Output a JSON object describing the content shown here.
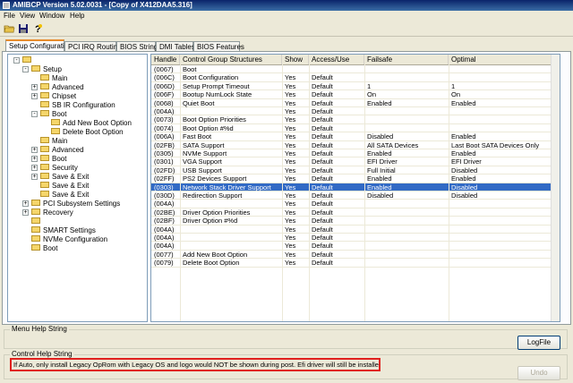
{
  "window": {
    "title": "AMIBCP Version 5.02.0031 - [Copy of X412DAA5.316]"
  },
  "menu": [
    "File",
    "View",
    "Window",
    "Help"
  ],
  "toolbar": {
    "icons": [
      "open-folder-icon",
      "save-icon",
      "help-icon"
    ]
  },
  "tabs": [
    {
      "label": "Setup Configuration",
      "active": true
    },
    {
      "label": "PCI IRQ Routing",
      "active": false
    },
    {
      "label": "BIOS Strings",
      "active": false
    },
    {
      "label": "DMI Tables",
      "active": false
    },
    {
      "label": "BIOS Features",
      "active": false
    }
  ],
  "tree": [
    {
      "label": "",
      "level": 0,
      "expander": "-"
    },
    {
      "label": "Setup",
      "level": 1,
      "expander": "-"
    },
    {
      "label": "Main",
      "level": 2,
      "expander": ""
    },
    {
      "label": "Advanced",
      "level": 2,
      "expander": "+"
    },
    {
      "label": "Chipset",
      "level": 2,
      "expander": "+"
    },
    {
      "label": "SB IR Configuration",
      "level": 2,
      "expander": ""
    },
    {
      "label": "Boot",
      "level": 2,
      "expander": "-"
    },
    {
      "label": "Add New Boot Option",
      "level": 3,
      "expander": ""
    },
    {
      "label": "Delete Boot Option",
      "level": 3,
      "expander": ""
    },
    {
      "label": "Main",
      "level": 2,
      "expander": ""
    },
    {
      "label": "Advanced",
      "level": 2,
      "expander": "+"
    },
    {
      "label": "Boot",
      "level": 2,
      "expander": "+"
    },
    {
      "label": "Security",
      "level": 2,
      "expander": "+"
    },
    {
      "label": "Save & Exit",
      "level": 2,
      "expander": "+"
    },
    {
      "label": "Save & Exit",
      "level": 2,
      "expander": ""
    },
    {
      "label": "Save & Exit",
      "level": 2,
      "expander": ""
    },
    {
      "label": "PCI Subsystem Settings",
      "level": 1,
      "expander": "+"
    },
    {
      "label": "Recovery",
      "level": 1,
      "expander": "+"
    },
    {
      "label": "",
      "level": 1,
      "expander": ""
    },
    {
      "label": "SMART Settings",
      "level": 1,
      "expander": ""
    },
    {
      "label": "NVMe Configuration",
      "level": 1,
      "expander": ""
    },
    {
      "label": "Boot",
      "level": 1,
      "expander": ""
    }
  ],
  "grid": {
    "columns": [
      "Handle",
      "Control Group Structures",
      "Show",
      "Access/Use",
      "Failsafe",
      "Optimal"
    ],
    "selected_index": 14,
    "rows": [
      [
        "(0067)",
        "Boot",
        "",
        "",
        "",
        ""
      ],
      [
        "(006C)",
        "Boot Configuration",
        "Yes",
        "Default",
        "",
        ""
      ],
      [
        "(006D)",
        "Setup Prompt Timeout",
        "Yes",
        "Default",
        "1",
        "1"
      ],
      [
        "(006F)",
        "Bootup NumLock State",
        "Yes",
        "Default",
        "On",
        "On"
      ],
      [
        "(0068)",
        "Quiet Boot",
        "Yes",
        "Default",
        "Enabled",
        "Enabled"
      ],
      [
        "(004A)",
        "",
        "Yes",
        "Default",
        "",
        ""
      ],
      [
        "(0073)",
        "Boot Option Priorities",
        "Yes",
        "Default",
        "",
        ""
      ],
      [
        "(0074)",
        "Boot Option #%d",
        "Yes",
        "Default",
        "",
        ""
      ],
      [
        "(006A)",
        "Fast Boot",
        "Yes",
        "Default",
        "Disabled",
        "Enabled"
      ],
      [
        "(02FB)",
        "SATA Support",
        "Yes",
        "Default",
        "All SATA Devices",
        "Last Boot SATA Devices Only"
      ],
      [
        "(0305)",
        "NVMe Support",
        "Yes",
        "Default",
        "Enabled",
        "Enabled"
      ],
      [
        "(0301)",
        "VGA Support",
        "Yes",
        "Default",
        "EFI Driver",
        "EFI Driver"
      ],
      [
        "(02FD)",
        "USB Support",
        "Yes",
        "Default",
        "Full Initial",
        "Disabled"
      ],
      [
        "(02FF)",
        "PS2 Devices Support",
        "Yes",
        "Default",
        "Enabled",
        "Enabled"
      ],
      [
        "(0303)",
        "Network Stack Driver Support",
        "Yes",
        "Default",
        "Enabled",
        "Disabled"
      ],
      [
        "(030D)",
        "Redirection Support",
        "Yes",
        "Default",
        "Disabled",
        "Disabled"
      ],
      [
        "(004A)",
        "",
        "Yes",
        "Default",
        "",
        ""
      ],
      [
        "(02BE)",
        "Driver Option Priorities",
        "Yes",
        "Default",
        "",
        ""
      ],
      [
        "(02BF)",
        "Driver Option #%d",
        "Yes",
        "Default",
        "",
        ""
      ],
      [
        "(004A)",
        "",
        "Yes",
        "Default",
        "",
        ""
      ],
      [
        "(004A)",
        "",
        "Yes",
        "Default",
        "",
        ""
      ],
      [
        "(004A)",
        "",
        "Yes",
        "Default",
        "",
        ""
      ],
      [
        "(0077)",
        "Add New Boot Option",
        "Yes",
        "Default",
        "",
        ""
      ],
      [
        "(0079)",
        "Delete Boot Option",
        "Yes",
        "Default",
        "",
        ""
      ]
    ]
  },
  "menu_help": {
    "label": "Menu Help String",
    "text": ""
  },
  "control_help": {
    "label": "Control Help String",
    "text": "If Auto, only install Legacy OpRom with Legacy OS and logo would NOT be shown during post. Efi driver will still be installed with EFI OS."
  },
  "buttons": {
    "logfile": "LogFile",
    "undo": "Undo"
  },
  "colors": {
    "selection": "#316ac5",
    "highlight_border": "#e0201e",
    "titlebar": "#0a246a"
  }
}
